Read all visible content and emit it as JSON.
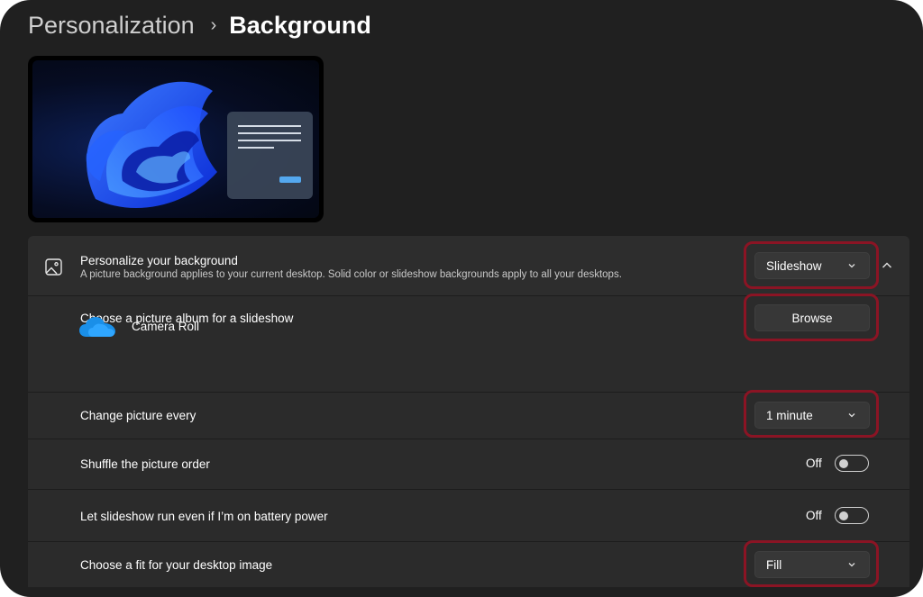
{
  "breadcrumb": {
    "parent": "Personalization",
    "separator": "›",
    "current": "Background"
  },
  "preview": {
    "label": "desktop-preview"
  },
  "personalize": {
    "title": "Personalize your background",
    "description": "A picture background applies to your current desktop. Solid color or slideshow backgrounds apply to all your desktops.",
    "selected": "Slideshow"
  },
  "album": {
    "title": "Choose a picture album for a slideshow",
    "button": "Browse",
    "folder_name": "Camera Roll"
  },
  "interval": {
    "title": "Change picture every",
    "selected": "1 minute"
  },
  "shuffle": {
    "title": "Shuffle the picture order",
    "state": "Off"
  },
  "battery": {
    "title": "Let slideshow run even if I’m on battery power",
    "state": "Off"
  },
  "fit": {
    "title": "Choose a fit for your desktop image",
    "selected": "Fill"
  },
  "colors": {
    "window_bg": "#202020",
    "card_bg": "#2b2b2b",
    "highlight": "#8b1424",
    "accent": "#5ab4ff"
  }
}
